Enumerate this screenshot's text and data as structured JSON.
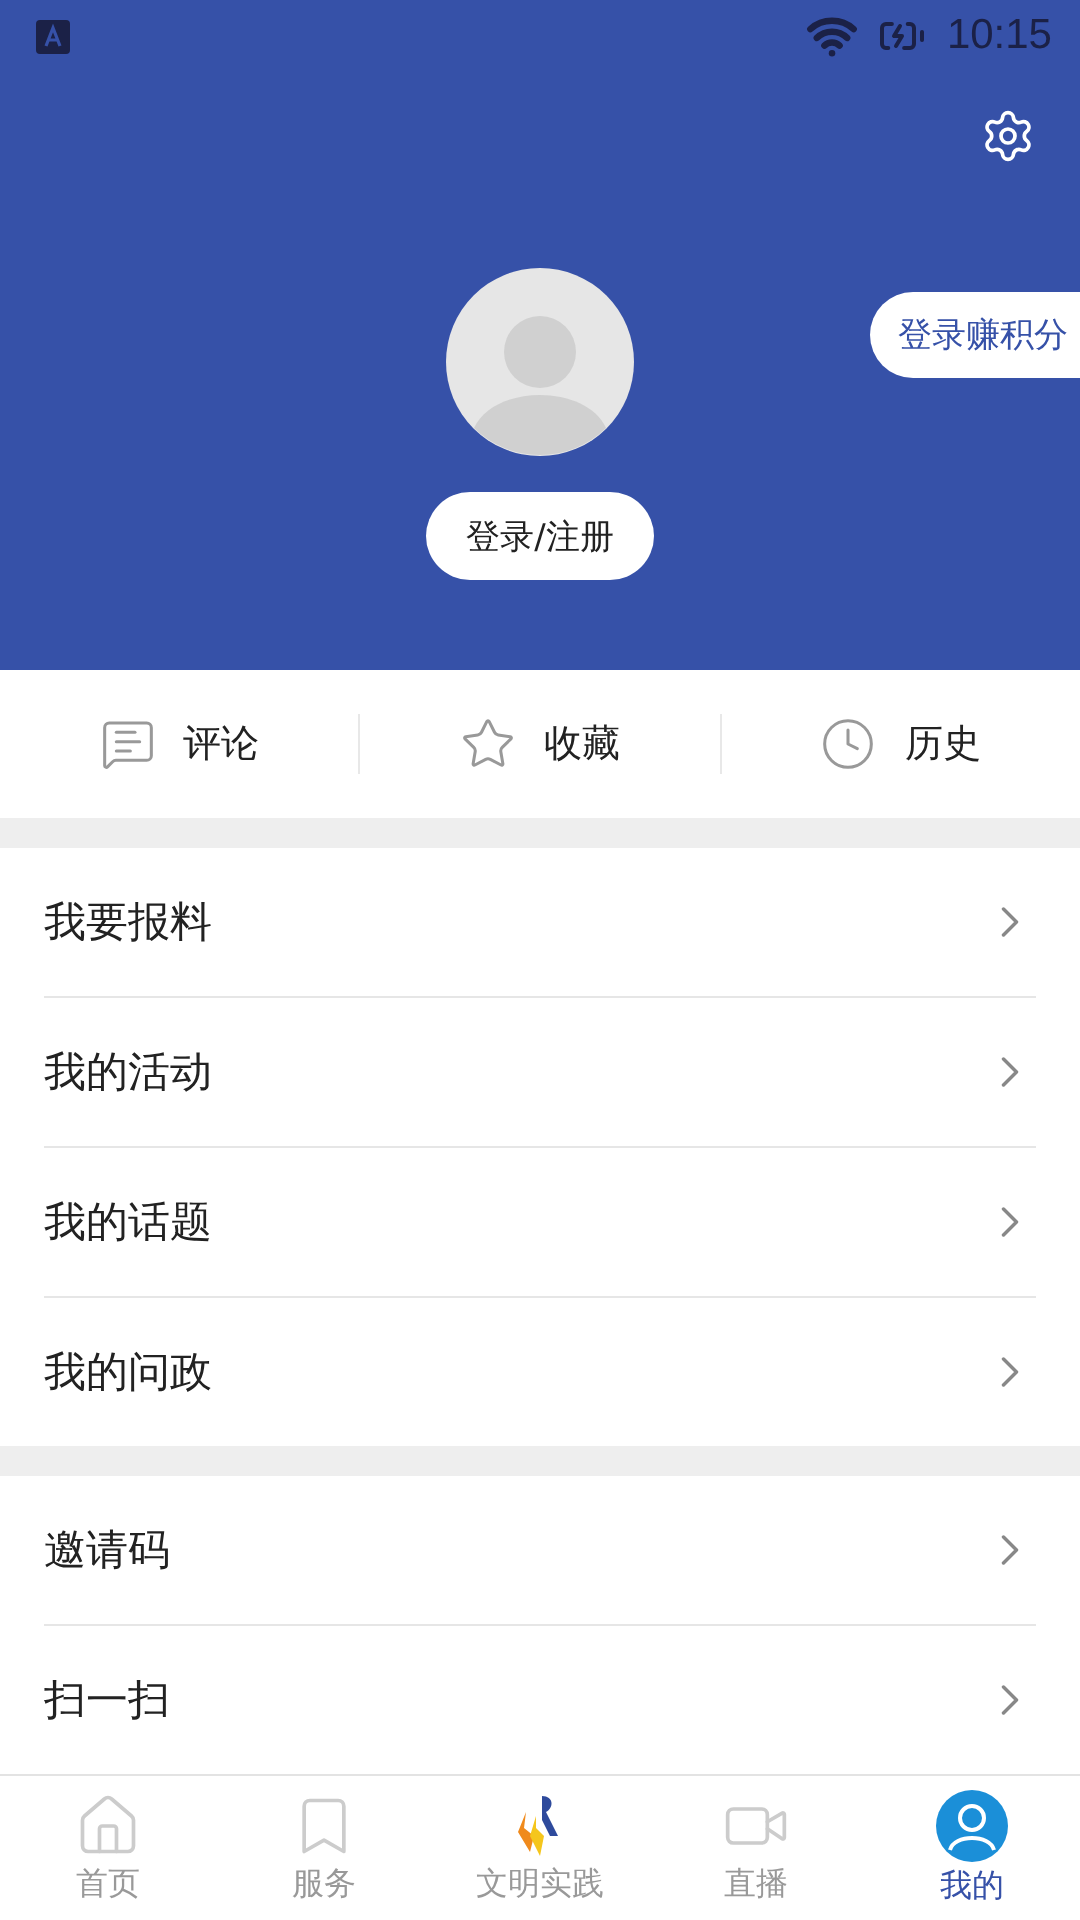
{
  "status_bar": {
    "time": "10:15"
  },
  "header": {
    "points_button": "登录赚积分",
    "login_button": "登录/注册"
  },
  "shortcuts": [
    {
      "label": "评论"
    },
    {
      "label": "收藏"
    },
    {
      "label": "历史"
    }
  ],
  "menu_groups": [
    {
      "items": [
        {
          "label": "我要报料"
        },
        {
          "label": "我的活动"
        },
        {
          "label": "我的话题"
        },
        {
          "label": "我的问政"
        }
      ]
    },
    {
      "items": [
        {
          "label": "邀请码"
        },
        {
          "label": "扫一扫"
        }
      ]
    }
  ],
  "tab_bar": [
    {
      "label": "首页",
      "selected": false
    },
    {
      "label": "服务",
      "selected": false
    },
    {
      "label": "文明实践",
      "selected": false
    },
    {
      "label": "直播",
      "selected": false
    },
    {
      "label": "我的",
      "selected": true
    }
  ]
}
